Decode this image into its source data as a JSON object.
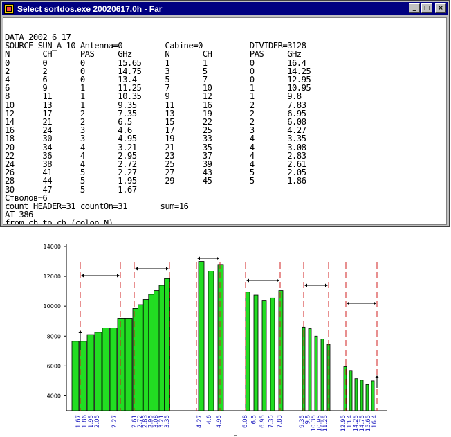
{
  "window": {
    "title": "Select sortdos.exe 20020617.0h - Far",
    "controls": {
      "minimize": "_",
      "maximize": "□",
      "close": "×"
    }
  },
  "console": {
    "lines": [
      "DATA 2002 6 17",
      "SOURCE SUN_A-10 Antenna=0         Cabine=0          DIVIDER=3128",
      "N       CH      PAS     GHz       N       CH        PAS     GHz",
      "0       0       0       15.65     1       1         0       16.4",
      "2       2       0       14.75     3       5         0       14.25",
      "4       6       0       13.4      5       7         0       12.95",
      "6       9       1       11.25     7       10        1       10.95",
      "8       11      1       10.35     9       12        1       9.8",
      "10      13      1       9.35      11      16        2       7.83",
      "12      17      2       7.35      13      19        2       6.95",
      "14      21      2       6.5       15      22        2       6.08",
      "16      24      3       4.6       17      25        3       4.27",
      "18      30      3       4.95      19      33        4       3.35",
      "20      34      4       3.21      21      35        4       3.08",
      "22      36      4       2.95      23      37        4       2.83",
      "24      38      4       2.72      25      39        4       2.61",
      "26      41      5       2.27      27      43        5       2.05",
      "28      44      5       1.95      29      45        5       1.86",
      "30      47      5       1.67",
      "Стволов=6",
      "count HEADER=31 countOn=31       sum=16",
      "AT-386",
      "from ch to ch (colon N)"
    ]
  },
  "chart_data": {
    "type": "bar",
    "ylim": [
      3000,
      14000
    ],
    "yticks": [
      "4000",
      "6000",
      "8000",
      "10000",
      "12000",
      "14000"
    ],
    "xlabel": "Г",
    "ylabel": "",
    "bar_color": "#22dd22",
    "groups": [
      {
        "categories": [
          "1.67",
          "1.86",
          "1.95",
          "2.05",
          "2.27"
        ],
        "bars": [
          7650,
          7650,
          8100,
          8250,
          8550,
          8550,
          9200,
          9200
        ]
      },
      {
        "categories": [
          "2.61",
          "2.72",
          "2.83",
          "2.95",
          "3.08",
          "3.21",
          "3.35"
        ],
        "bars": [
          9850,
          10100,
          10450,
          10800,
          11050,
          11400,
          11850
        ]
      },
      {
        "categories": [
          "4.27",
          "4.6",
          "4.95"
        ],
        "bars": [
          13000,
          12350,
          12800
        ]
      },
      {
        "categories": [
          "6.08",
          "6.5",
          "6.95",
          "7.35",
          "7.83"
        ],
        "bars": [
          10950,
          10750,
          10400,
          10550,
          11050
        ]
      },
      {
        "categories": [
          "9.35",
          "9.8",
          "10.35",
          "10.95",
          "11.25"
        ],
        "bars": [
          8600,
          8500,
          8000,
          7800,
          7450
        ]
      },
      {
        "categories": [
          "12.95",
          "13.4",
          "14.25",
          "14.75",
          "15.65",
          "16.4"
        ],
        "bars": [
          5950,
          5700,
          5150,
          5050,
          4750,
          5000
        ]
      }
    ]
  }
}
